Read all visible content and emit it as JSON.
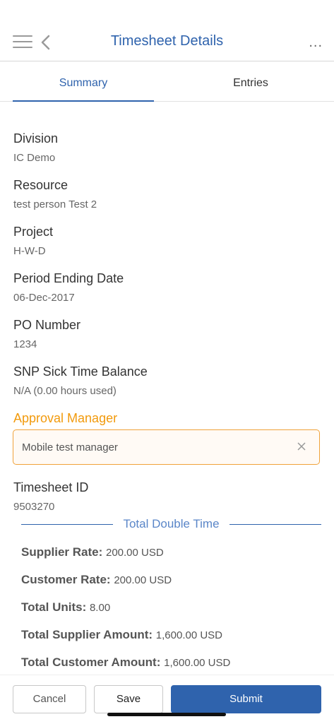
{
  "header": {
    "title": "Timesheet Details",
    "more": "..."
  },
  "tabs": [
    {
      "label": "Summary"
    },
    {
      "label": "Entries"
    }
  ],
  "fields": [
    {
      "label": "Division",
      "value": "IC Demo"
    },
    {
      "label": "Resource",
      "value": "test person Test 2"
    },
    {
      "label": "Project",
      "value": "H-W-D"
    },
    {
      "label": "Period Ending Date",
      "value": "06-Dec-2017"
    },
    {
      "label": "PO Number",
      "value": "1234"
    },
    {
      "label": "SNP Sick Time Balance",
      "value": "N/A (0.00 hours used)"
    }
  ],
  "approval": {
    "label": "Approval Manager",
    "value": "Mobile test manager"
  },
  "timesheet_id": {
    "label": "Timesheet ID",
    "value": "9503270"
  },
  "section": {
    "title": "Total Double Time"
  },
  "rates": [
    {
      "label": "Supplier Rate:",
      "value": "200.00 USD"
    },
    {
      "label": "Customer Rate:",
      "value": "200.00 USD"
    },
    {
      "label": "Total Units:",
      "value": "8.00"
    },
    {
      "label": "Total Supplier Amount:",
      "value": "1,600.00 USD"
    },
    {
      "label": "Total Customer Amount:",
      "value": "1,600.00 USD"
    }
  ],
  "footer": {
    "cancel": "Cancel",
    "save": "Save",
    "submit": "Submit"
  },
  "colors": {
    "primary": "#2f63ad",
    "accent": "#f29a0c"
  }
}
